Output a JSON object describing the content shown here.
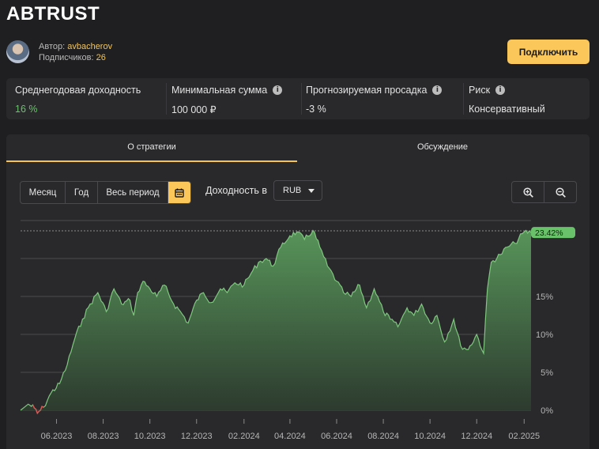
{
  "strategy": {
    "title": "ABTRUST"
  },
  "author": {
    "label": "Автор:",
    "name": "avbacherov",
    "subscribers_label": "Подписчиков:",
    "subscribers": "26"
  },
  "actions": {
    "connect_label": "Подключить"
  },
  "stats": [
    {
      "label": "Среднегодовая доходность",
      "value": "16 %",
      "info": false
    },
    {
      "label": "Минимальная сумма",
      "value": "100 000 ₽",
      "info": true
    },
    {
      "label": "Прогнозируемая просадка",
      "value": "-3 %",
      "info": true
    },
    {
      "label": "Риск",
      "value": "Консервативный",
      "info": true
    }
  ],
  "tabs": [
    {
      "label": "О стратегии",
      "active": true
    },
    {
      "label": "Обсуждение",
      "active": false
    }
  ],
  "period": {
    "buttons": [
      "Месяц",
      "Год",
      "Весь период"
    ],
    "calendar_icon": "calendar-icon"
  },
  "yield_currency": {
    "label": "Доходность в",
    "selected": "RUB"
  },
  "zoom": {
    "zoom_in_icon": "zoom-in-icon",
    "zoom_out_icon": "zoom-out-icon"
  },
  "colors": {
    "accent": "#fcc75a",
    "positive": "#69c26a",
    "line": "#7fc77f",
    "negative": "#e05454",
    "panel": "#29292c"
  },
  "chart_data": {
    "type": "area",
    "title": "",
    "xlabel": "",
    "ylabel": "",
    "x_ticks": [
      "06.2023",
      "08.2023",
      "10.2023",
      "12.2023",
      "02.2024",
      "04.2024",
      "06.2024",
      "08.2024",
      "10.2024",
      "12.2024",
      "02.2025"
    ],
    "y_ticks": [
      "0%",
      "5%",
      "10%",
      "15%"
    ],
    "ylim": [
      0,
      25
    ],
    "current_value_label": "23.42%",
    "grid": true,
    "series": [
      {
        "unit": "%",
        "x": [
          "2023-04-15",
          "2023-04-25",
          "2023-05-03",
          "2023-05-07",
          "2023-05-15",
          "2023-05-25",
          "2023-06-05",
          "2023-06-15",
          "2023-06-25",
          "2023-07-05",
          "2023-07-15",
          "2023-07-25",
          "2023-08-05",
          "2023-08-15",
          "2023-08-25",
          "2023-09-05",
          "2023-09-10",
          "2023-09-15",
          "2023-09-22",
          "2023-10-01",
          "2023-10-10",
          "2023-10-20",
          "2023-11-01",
          "2023-11-10",
          "2023-11-20",
          "2023-12-01",
          "2023-12-10",
          "2023-12-20",
          "2024-01-01",
          "2024-01-10",
          "2024-01-20",
          "2024-02-01",
          "2024-02-10",
          "2024-02-20",
          "2024-03-01",
          "2024-03-10",
          "2024-03-20",
          "2024-04-01",
          "2024-04-10",
          "2024-04-20",
          "2024-05-01",
          "2024-05-10",
          "2024-05-20",
          "2024-06-01",
          "2024-06-10",
          "2024-06-20",
          "2024-07-01",
          "2024-07-10",
          "2024-07-20",
          "2024-08-01",
          "2024-08-10",
          "2024-08-20",
          "2024-09-01",
          "2024-09-10",
          "2024-09-20",
          "2024-10-01",
          "2024-10-10",
          "2024-10-20",
          "2024-11-01",
          "2024-11-10",
          "2024-11-20",
          "2024-12-01",
          "2024-12-10",
          "2024-12-15",
          "2024-12-20",
          "2025-01-01",
          "2025-01-10",
          "2025-01-20",
          "2025-02-01",
          "2025-02-10"
        ],
        "values": [
          0,
          0.8,
          0.3,
          -0.4,
          0.4,
          2.3,
          3.5,
          6.0,
          9.5,
          12.0,
          14.0,
          15.5,
          13.0,
          16.0,
          14.0,
          14.5,
          12.5,
          15.5,
          17.0,
          16.0,
          15.0,
          16.5,
          14.0,
          13.0,
          11.5,
          14.5,
          15.5,
          14.2,
          16.0,
          15.5,
          16.8,
          16.5,
          18.0,
          19.5,
          20.0,
          19.0,
          21.5,
          23.0,
          23.5,
          22.5,
          23.7,
          21.5,
          19.0,
          17.0,
          15.5,
          15.0,
          16.5,
          13.5,
          16.0,
          13.0,
          12.0,
          11.0,
          13.5,
          12.5,
          14.0,
          11.5,
          12.5,
          9.0,
          12.0,
          8.5,
          8.0,
          10.0,
          7.5,
          16.0,
          19.5,
          20.5,
          21.5,
          22.0,
          23.5,
          23.42
        ]
      }
    ]
  }
}
